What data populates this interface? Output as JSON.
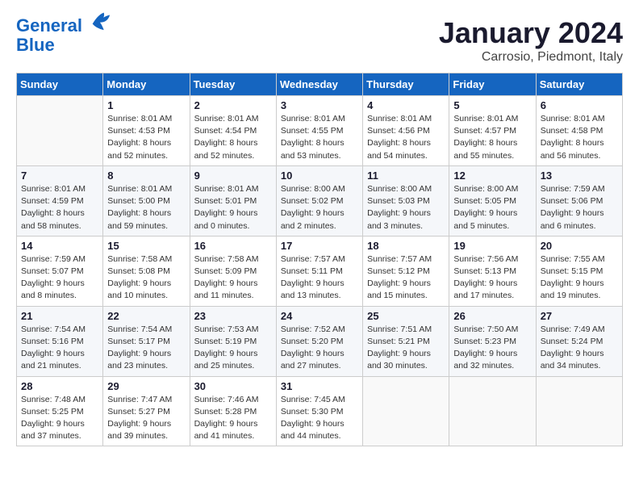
{
  "logo": {
    "line1": "General",
    "line2": "Blue"
  },
  "title": "January 2024",
  "subtitle": "Carrosio, Piedmont, Italy",
  "days_header": [
    "Sunday",
    "Monday",
    "Tuesday",
    "Wednesday",
    "Thursday",
    "Friday",
    "Saturday"
  ],
  "weeks": [
    [
      {
        "num": "",
        "info": ""
      },
      {
        "num": "1",
        "info": "Sunrise: 8:01 AM\nSunset: 4:53 PM\nDaylight: 8 hours\nand 52 minutes."
      },
      {
        "num": "2",
        "info": "Sunrise: 8:01 AM\nSunset: 4:54 PM\nDaylight: 8 hours\nand 52 minutes."
      },
      {
        "num": "3",
        "info": "Sunrise: 8:01 AM\nSunset: 4:55 PM\nDaylight: 8 hours\nand 53 minutes."
      },
      {
        "num": "4",
        "info": "Sunrise: 8:01 AM\nSunset: 4:56 PM\nDaylight: 8 hours\nand 54 minutes."
      },
      {
        "num": "5",
        "info": "Sunrise: 8:01 AM\nSunset: 4:57 PM\nDaylight: 8 hours\nand 55 minutes."
      },
      {
        "num": "6",
        "info": "Sunrise: 8:01 AM\nSunset: 4:58 PM\nDaylight: 8 hours\nand 56 minutes."
      }
    ],
    [
      {
        "num": "7",
        "info": "Sunrise: 8:01 AM\nSunset: 4:59 PM\nDaylight: 8 hours\nand 58 minutes."
      },
      {
        "num": "8",
        "info": "Sunrise: 8:01 AM\nSunset: 5:00 PM\nDaylight: 8 hours\nand 59 minutes."
      },
      {
        "num": "9",
        "info": "Sunrise: 8:01 AM\nSunset: 5:01 PM\nDaylight: 9 hours\nand 0 minutes."
      },
      {
        "num": "10",
        "info": "Sunrise: 8:00 AM\nSunset: 5:02 PM\nDaylight: 9 hours\nand 2 minutes."
      },
      {
        "num": "11",
        "info": "Sunrise: 8:00 AM\nSunset: 5:03 PM\nDaylight: 9 hours\nand 3 minutes."
      },
      {
        "num": "12",
        "info": "Sunrise: 8:00 AM\nSunset: 5:05 PM\nDaylight: 9 hours\nand 5 minutes."
      },
      {
        "num": "13",
        "info": "Sunrise: 7:59 AM\nSunset: 5:06 PM\nDaylight: 9 hours\nand 6 minutes."
      }
    ],
    [
      {
        "num": "14",
        "info": "Sunrise: 7:59 AM\nSunset: 5:07 PM\nDaylight: 9 hours\nand 8 minutes."
      },
      {
        "num": "15",
        "info": "Sunrise: 7:58 AM\nSunset: 5:08 PM\nDaylight: 9 hours\nand 10 minutes."
      },
      {
        "num": "16",
        "info": "Sunrise: 7:58 AM\nSunset: 5:09 PM\nDaylight: 9 hours\nand 11 minutes."
      },
      {
        "num": "17",
        "info": "Sunrise: 7:57 AM\nSunset: 5:11 PM\nDaylight: 9 hours\nand 13 minutes."
      },
      {
        "num": "18",
        "info": "Sunrise: 7:57 AM\nSunset: 5:12 PM\nDaylight: 9 hours\nand 15 minutes."
      },
      {
        "num": "19",
        "info": "Sunrise: 7:56 AM\nSunset: 5:13 PM\nDaylight: 9 hours\nand 17 minutes."
      },
      {
        "num": "20",
        "info": "Sunrise: 7:55 AM\nSunset: 5:15 PM\nDaylight: 9 hours\nand 19 minutes."
      }
    ],
    [
      {
        "num": "21",
        "info": "Sunrise: 7:54 AM\nSunset: 5:16 PM\nDaylight: 9 hours\nand 21 minutes."
      },
      {
        "num": "22",
        "info": "Sunrise: 7:54 AM\nSunset: 5:17 PM\nDaylight: 9 hours\nand 23 minutes."
      },
      {
        "num": "23",
        "info": "Sunrise: 7:53 AM\nSunset: 5:19 PM\nDaylight: 9 hours\nand 25 minutes."
      },
      {
        "num": "24",
        "info": "Sunrise: 7:52 AM\nSunset: 5:20 PM\nDaylight: 9 hours\nand 27 minutes."
      },
      {
        "num": "25",
        "info": "Sunrise: 7:51 AM\nSunset: 5:21 PM\nDaylight: 9 hours\nand 30 minutes."
      },
      {
        "num": "26",
        "info": "Sunrise: 7:50 AM\nSunset: 5:23 PM\nDaylight: 9 hours\nand 32 minutes."
      },
      {
        "num": "27",
        "info": "Sunrise: 7:49 AM\nSunset: 5:24 PM\nDaylight: 9 hours\nand 34 minutes."
      }
    ],
    [
      {
        "num": "28",
        "info": "Sunrise: 7:48 AM\nSunset: 5:25 PM\nDaylight: 9 hours\nand 37 minutes."
      },
      {
        "num": "29",
        "info": "Sunrise: 7:47 AM\nSunset: 5:27 PM\nDaylight: 9 hours\nand 39 minutes."
      },
      {
        "num": "30",
        "info": "Sunrise: 7:46 AM\nSunset: 5:28 PM\nDaylight: 9 hours\nand 41 minutes."
      },
      {
        "num": "31",
        "info": "Sunrise: 7:45 AM\nSunset: 5:30 PM\nDaylight: 9 hours\nand 44 minutes."
      },
      {
        "num": "",
        "info": ""
      },
      {
        "num": "",
        "info": ""
      },
      {
        "num": "",
        "info": ""
      }
    ]
  ]
}
